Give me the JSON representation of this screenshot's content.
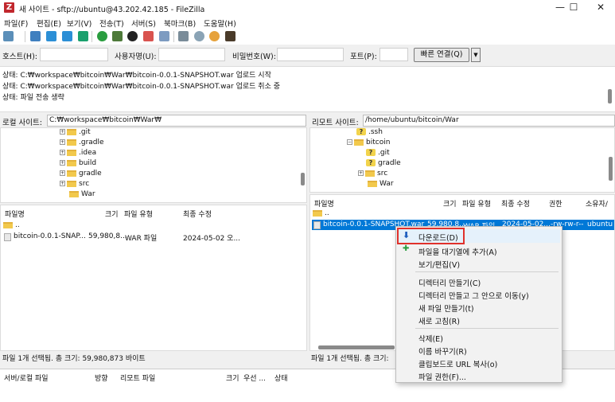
{
  "window": {
    "icon_letter": "Z",
    "title": "새 사이트 - sftp://ubuntu@43.202.42.185 - FileZilla",
    "min": "—",
    "max": "☐",
    "close": "✕"
  },
  "menu": [
    "파일(F)",
    "편집(E)",
    "보기(V)",
    "전송(T)",
    "서버(S)",
    "북마크(B)",
    "도움말(H)"
  ],
  "quickconnect": {
    "host_label": "호스트(H):",
    "user_label": "사용자명(U):",
    "pass_label": "비밀번호(W):",
    "port_label": "포트(P):",
    "connect_button": "빠른 연결(Q)",
    "dropdown": "▼"
  },
  "log": [
    "상태:  C:₩workspace₩bitcoin₩War₩bitcoin-0.0.1-SNAPSHOT.war 업로드 시작",
    "상태:  C:₩workspace₩bitcoin₩War₩bitcoin-0.0.1-SNAPSHOT.war 업로드 취소 중",
    "상태:  파일 전송 생략"
  ],
  "local": {
    "site_label": "로컬 사이트:",
    "site_path": "C:₩workspace₩bitcoin₩War₩",
    "tree": [
      ".git",
      ".gradle",
      ".idea",
      "build",
      "gradle",
      "src",
      "War"
    ],
    "headers": {
      "name": "파일명",
      "size": "크기",
      "type": "파일 유형",
      "modified": "최종 수정"
    },
    "parent": "..",
    "files": [
      {
        "name": "bitcoin-0.0.1-SNAP...",
        "size": "59,980,8...",
        "type": "WAR 파일",
        "modified": "2024-05-02 오..."
      }
    ],
    "status": "파일 1개 선택됨. 총 크기: 59,980,873 바이트"
  },
  "remote": {
    "site_label": "리모트 사이트:",
    "site_path": "/home/ubuntu/bitcoin/War",
    "tree": [
      {
        "name": ".ssh",
        "icon": "question-folder"
      },
      {
        "name": "bitcoin",
        "icon": "folder"
      },
      {
        "name": ".git",
        "icon": "question-folder"
      },
      {
        "name": "gradle",
        "icon": "question-folder"
      },
      {
        "name": "src",
        "icon": "folder"
      },
      {
        "name": "War",
        "icon": "folder"
      }
    ],
    "headers": {
      "name": "파일명",
      "size": "크기",
      "type": "파일 유형",
      "modified": "최종 수정",
      "perms": "권한",
      "owner": "소유자/"
    },
    "parent": "..",
    "files": [
      {
        "name": "bitcoin-0.0.1-SNAPSHOT.war",
        "size": "59,980,8...",
        "type": "WAR 파일",
        "modified": "2024-05-02...",
        "perms": "-rw-rw-r--",
        "owner": "ubuntu"
      }
    ],
    "status": "파일 1개 선택됨. 총 크기:"
  },
  "queue_headers": {
    "file": "서버/로컬 파일",
    "dir": "방향",
    "remote": "리모트 파일",
    "size": "크기",
    "priority": "우선 ...",
    "status": "상태"
  },
  "context_menu": {
    "download": "다운로드(D)",
    "add_queue": "파일을 대기열에 추가(A)",
    "view_edit": "보기/편집(V)",
    "mkdir": "디렉터리 만들기(C)",
    "mkdir_enter": "디렉터리 만들고 그 안으로 이동(y)",
    "new_file": "새 파일 만들기(t)",
    "refresh": "새로 고침(R)",
    "delete": "삭제(E)",
    "rename": "이름 바꾸기(R)",
    "copy_url": "클립보드로 URL 복사(o)",
    "permissions": "파일 권한(F)..."
  },
  "colors": {
    "accent": "#0078d7",
    "highlight_box": "#e0312b",
    "selection_bg": "#cce4f7"
  }
}
